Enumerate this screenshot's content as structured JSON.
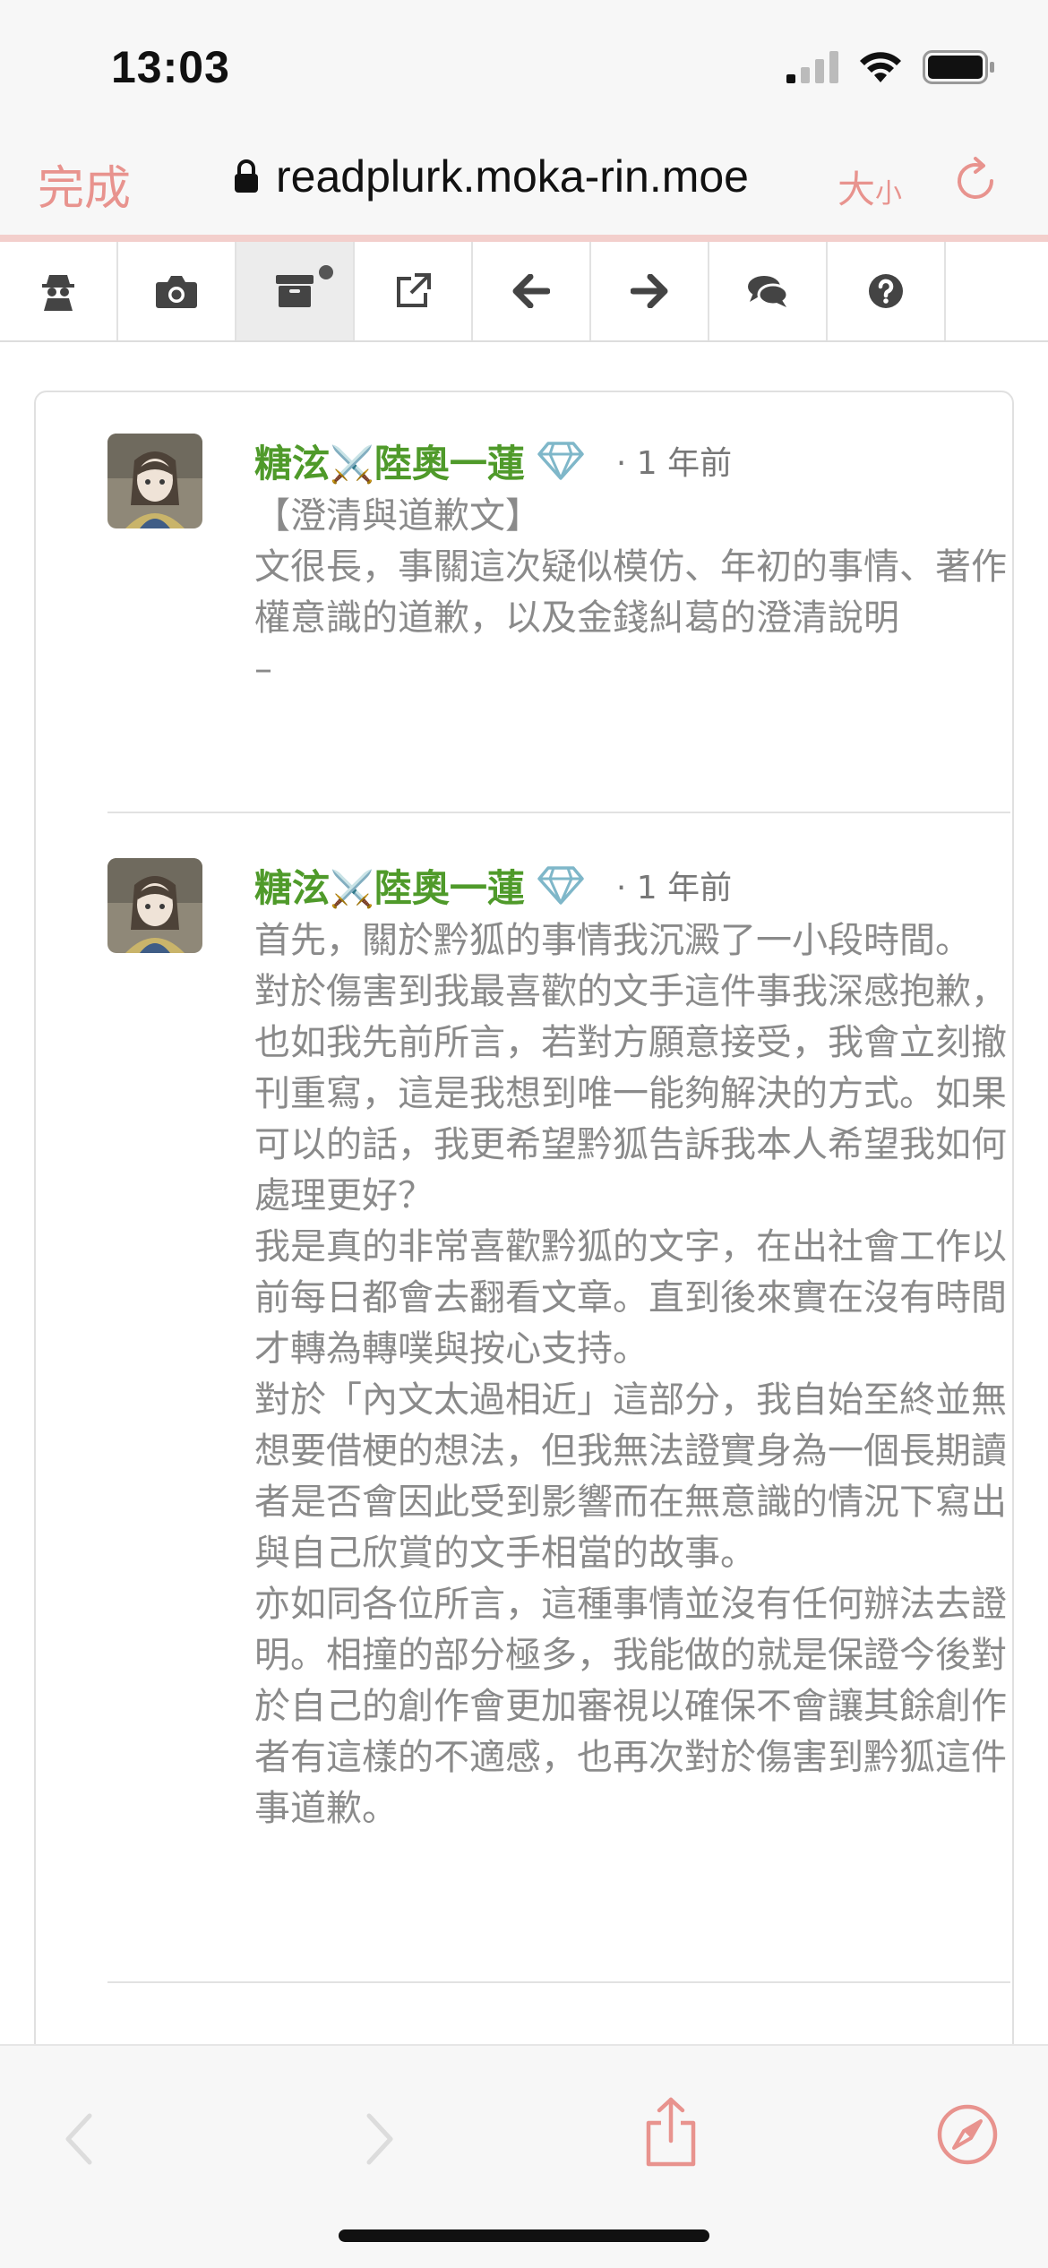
{
  "status": {
    "time": "13:03"
  },
  "browser": {
    "done_label": "完成",
    "url": "readplurk.moka-rin.moe",
    "size_label_big": "大",
    "size_label_small": "小"
  },
  "toolbar": {
    "items": [
      {
        "icon": "spy-icon"
      },
      {
        "icon": "camera-icon"
      },
      {
        "icon": "archive-icon"
      },
      {
        "icon": "external-link-icon"
      },
      {
        "icon": "arrow-left-icon"
      },
      {
        "icon": "arrow-right-icon"
      },
      {
        "icon": "comments-icon"
      },
      {
        "icon": "help-icon"
      }
    ]
  },
  "posts": [
    {
      "author_a": "糖泫",
      "author_b": "陸奧一蓮",
      "time": "· 1 年前",
      "body": "【澄清與道歉文】\n文很長，事關這次疑似模仿、年初的事情、著作權意識的道歉，以及金錢糾葛的澄清說明\n–"
    },
    {
      "author_a": "糖泫",
      "author_b": "陸奧一蓮",
      "time": "· 1 年前",
      "body": "首先，關於黔狐的事情我沉澱了一小段時間。\n對於傷害到我最喜歡的文手這件事我深感抱歉，也如我先前所言，若對方願意接受，我會立刻撤刊重寫，這是我想到唯一能夠解決的方式。如果可以的話，我更希望黔狐告訴我本人希望我如何處理更好？\n我是真的非常喜歡黔狐的文字，在出社會工作以前每日都會去翻看文章。直到後來實在沒有時間才轉為轉噗與按心支持。\n對於「內文太過相近」這部分，我自始至終並無想要借梗的想法，但我無法證實身為一個長期讀者是否會因此受到影響而在無意識的情況下寫出與自己欣賞的文手相當的故事。\n亦如同各位所言，這種事情並沒有任何辦法去證明。相撞的部分極多，我能做的就是保證今後對於自己的創作會更加審視以確保不會讓其餘創作者有這樣的不適感，也再次對於傷害到黔狐這件事道歉。"
    }
  ],
  "colors": {
    "accent": "#e8938e",
    "author": "#4f9a2a",
    "body_text": "#8a8a8a"
  }
}
